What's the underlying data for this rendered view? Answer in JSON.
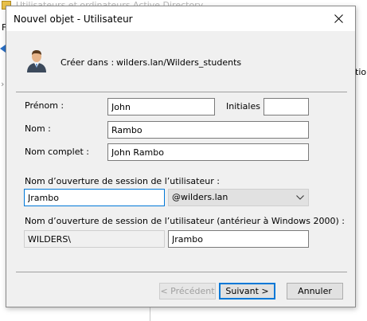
{
  "background": {
    "title": "Utilisateurs et ordinateurs Active Directory",
    "menu_letter": "F",
    "column_text": "tion"
  },
  "dialog": {
    "title": "Nouvel objet - Utilisateur",
    "create_in_label": "Créer dans :",
    "create_in_path": "wilders.lan/Wilders_students"
  },
  "form": {
    "first_name_label": "Prénom :",
    "first_name_value": "John",
    "initials_label": "Initiales :",
    "initials_value": "",
    "last_name_label": "Nom :",
    "last_name_value": "Rambo",
    "full_name_label": "Nom complet :",
    "full_name_value": "John Rambo",
    "logon_label": "Nom d’ouverture de session de l’utilisateur :",
    "logon_value": "Jrambo",
    "domain_suffix": "@wilders.lan",
    "legacy_logon_label": "Nom d’ouverture de session de l’utilisateur (antérieur à Windows 2000) :",
    "legacy_domain": "WILDERS\\",
    "legacy_logon_value": "Jrambo"
  },
  "buttons": {
    "previous": "< Précédent",
    "next": "Suivant >",
    "cancel": "Annuler"
  },
  "icons": {
    "close": "close-icon",
    "user": "user-icon",
    "dropdown": "chevron-down-icon"
  },
  "colors": {
    "dialog_bg": "#f0f0f0",
    "focus_border": "#0078d7",
    "button_bg": "#e1e1e1"
  }
}
